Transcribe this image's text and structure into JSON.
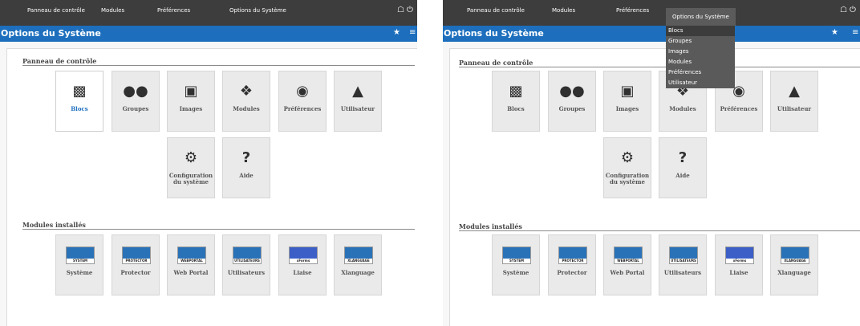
{
  "topnav": [
    "Panneau de contrôle",
    "Modules",
    "Préférences",
    "Options du Système"
  ],
  "page_title": "Options du Système",
  "sections": {
    "control_panel": "Panneau de contrôle",
    "installed_modules": "Modules installés"
  },
  "control_tiles": [
    {
      "label": "Blocs",
      "icon": "blocks-icon"
    },
    {
      "label": "Groupes",
      "icon": "groups-icon"
    },
    {
      "label": "Images",
      "icon": "images-icon"
    },
    {
      "label": "Modules",
      "icon": "modules-icon"
    },
    {
      "label": "Préférences",
      "icon": "preferences-icon"
    },
    {
      "label": "Utilisateur",
      "icon": "user-icon"
    },
    {
      "label": "Configuration du système",
      "icon": "gear-icon"
    },
    {
      "label": "Aide",
      "icon": "help-icon"
    }
  ],
  "modules": [
    {
      "label": "Système",
      "logo_text": "SYSTEM"
    },
    {
      "label": "Protector",
      "logo_text": "PROTECTOR"
    },
    {
      "label": "Web Portal",
      "logo_text": "WEBPORTAL"
    },
    {
      "label": "Utilisateurs",
      "logo_text": "UTILISATEURS"
    },
    {
      "label": "Liaise",
      "logo_text": "xForms"
    },
    {
      "label": "Xlanguage",
      "logo_text": "XLANGUAGE"
    }
  ],
  "dropdown_items": [
    "Blocs",
    "Groupes",
    "Images",
    "Modules",
    "Préférences",
    "Utilisateur"
  ],
  "colors": {
    "topbar": "#3d3d3d",
    "titlebar": "#1d6fbd",
    "accent": "#1d6fbd",
    "tile": "#eaeaea"
  }
}
